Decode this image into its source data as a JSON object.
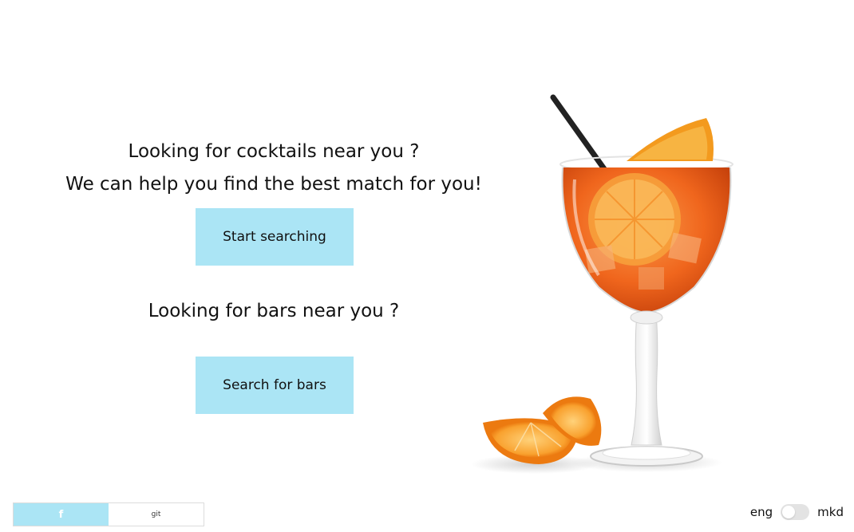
{
  "hero": {
    "line1": "Looking for cocktails near you ?",
    "line2": "We can help you find the best match for you!",
    "start_button": "Start searching",
    "bars_heading": "Looking for bars near you ?",
    "bars_button": "Search for bars"
  },
  "social": {
    "facebook_label": "f",
    "git_label": "git"
  },
  "language": {
    "left": "eng",
    "right": "mkd",
    "selected": "eng"
  },
  "colors": {
    "button_bg": "#abe5f5",
    "page_bg": "#ffffff",
    "cocktail": "#f26a1b"
  },
  "illustration": {
    "subject": "aperol-spritz-cocktail-with-orange-slices"
  }
}
